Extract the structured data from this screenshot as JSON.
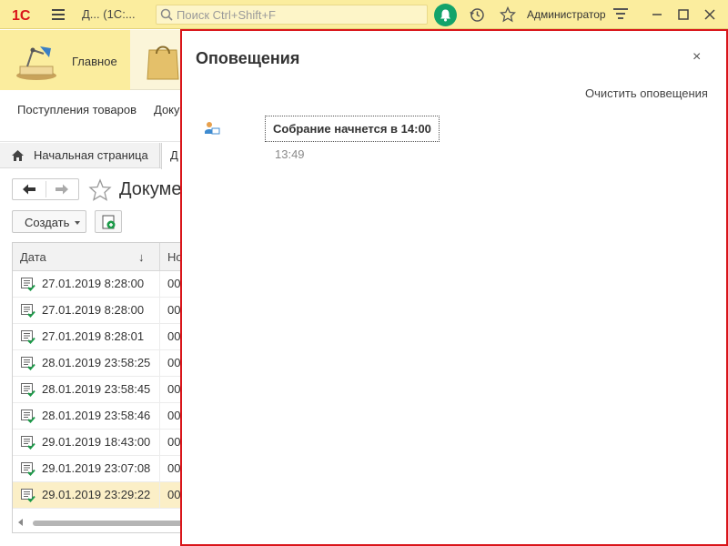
{
  "titlebar": {
    "logo": "1C",
    "title": "Д...  (1С:...",
    "search_placeholder": "Поиск Ctrl+Shift+F",
    "user": "Администратор",
    "bell_color": "#13a36a"
  },
  "sections": {
    "main_label": "Главное"
  },
  "functions": {
    "item1": "Поступления товаров",
    "item2": "Доку"
  },
  "tabs": {
    "home": "Начальная страница",
    "doc": "Д"
  },
  "form": {
    "title": "Докумен",
    "create_label": "Создать"
  },
  "table": {
    "columns": [
      "Дата",
      "Но"
    ],
    "sort_glyph": "↓",
    "rows": [
      {
        "date": "27.01.2019 8:28:00",
        "num": "00"
      },
      {
        "date": "27.01.2019 8:28:00",
        "num": "00"
      },
      {
        "date": "27.01.2019 8:28:01",
        "num": "00"
      },
      {
        "date": "28.01.2019 23:58:25",
        "num": "00"
      },
      {
        "date": "28.01.2019 23:58:45",
        "num": "00"
      },
      {
        "date": "28.01.2019 23:58:46",
        "num": "00"
      },
      {
        "date": "29.01.2019 18:43:00",
        "num": "00"
      },
      {
        "date": "29.01.2019 23:07:08",
        "num": "00"
      },
      {
        "date": "29.01.2019 23:29:22",
        "num": "00"
      }
    ],
    "selected_row": 8
  },
  "notifications": {
    "title": "Оповещения",
    "close_glyph": "×",
    "clear_label": "Очистить оповещения",
    "items": [
      {
        "text": "Собрание начнется в 14:00",
        "time": "13:49"
      }
    ],
    "border_color": "#d9151a"
  }
}
